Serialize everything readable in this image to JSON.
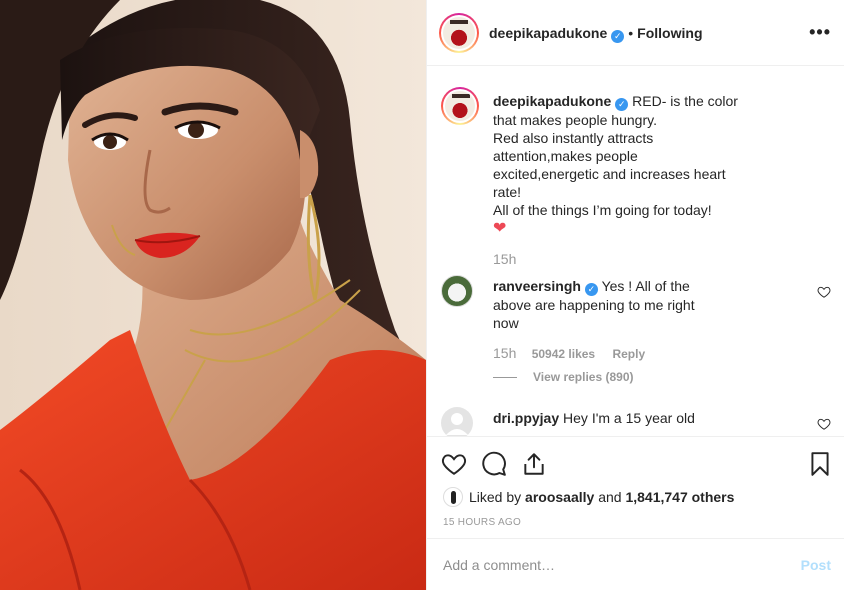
{
  "header": {
    "username": "deepikapadukone",
    "separator": "•",
    "follow_status": "Following",
    "more_label": "•••",
    "verified_mark": "✓"
  },
  "caption": {
    "username": "deepikapadukone",
    "text_lines": [
      "RED- is the color",
      "that makes people hungry.",
      "Red also instantly attracts",
      "attention,makes people",
      "excited,energetic and increases heart",
      "rate!",
      "All of the things I’m going for today!"
    ],
    "emoji": "❤",
    "time": "15h"
  },
  "comments": [
    {
      "username": "ranveersingh",
      "text_lines": [
        "Yes ! All of the",
        "above are happening to me right",
        "now"
      ],
      "time": "15h",
      "likes": "50942 likes",
      "reply": "Reply",
      "view_replies": "View replies (890)"
    },
    {
      "username": "dri.ppyjay",
      "text_lines": [
        "Hey I'm a 15 year old"
      ]
    }
  ],
  "actions": {
    "like_icon": "heart-icon",
    "comment_icon": "comment-icon",
    "share_icon": "share-icon",
    "save_icon": "bookmark-icon"
  },
  "likes_row": {
    "prefix": "Liked by",
    "liker": "aroosaally",
    "middle": "and",
    "count": "1,841,747 others"
  },
  "timestamp": "15 HOURS AGO",
  "add_comment": {
    "placeholder": "Add a comment…",
    "post_label": "Post"
  },
  "colors": {
    "verified": "#3897f0",
    "post_disabled": "#b2dffc",
    "heart": "#ed4956"
  }
}
